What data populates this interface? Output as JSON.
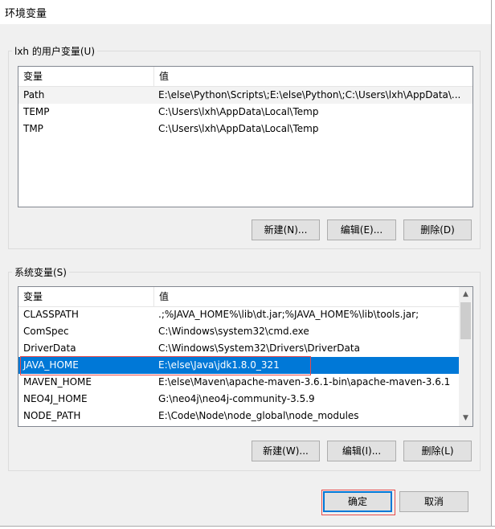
{
  "window": {
    "title": "环境变量"
  },
  "user_vars": {
    "group_label": "lxh 的用户变量(U)",
    "columns": [
      "变量",
      "值"
    ],
    "rows": [
      {
        "name": "Path",
        "value": "E:\\else\\Python\\Scripts\\;E:\\else\\Python\\;C:\\Users\\lxh\\AppData\\..."
      },
      {
        "name": "TEMP",
        "value": "C:\\Users\\lxh\\AppData\\Local\\Temp"
      },
      {
        "name": "TMP",
        "value": "C:\\Users\\lxh\\AppData\\Local\\Temp"
      }
    ],
    "buttons": {
      "new": "新建(N)...",
      "edit": "编辑(E)...",
      "delete": "删除(D)"
    }
  },
  "system_vars": {
    "group_label": "系统变量(S)",
    "columns": [
      "变量",
      "值"
    ],
    "rows": [
      {
        "name": "CLASSPATH",
        "value": ".;%JAVA_HOME%\\lib\\dt.jar;%JAVA_HOME%\\lib\\tools.jar;"
      },
      {
        "name": "ComSpec",
        "value": "C:\\Windows\\system32\\cmd.exe"
      },
      {
        "name": "DriverData",
        "value": "C:\\Windows\\System32\\Drivers\\DriverData"
      },
      {
        "name": "JAVA_HOME",
        "value": "E:\\else\\Java\\jdk1.8.0_321"
      },
      {
        "name": "MAVEN_HOME",
        "value": "E:\\else\\Maven\\apache-maven-3.6.1-bin\\apache-maven-3.6.1"
      },
      {
        "name": "NEO4J_HOME",
        "value": "G:\\neo4j\\neo4j-community-3.5.9"
      },
      {
        "name": "NODE_PATH",
        "value": "E:\\Code\\Node\\node_global\\node_modules"
      }
    ],
    "selected_index": 3,
    "buttons": {
      "new": "新建(W)...",
      "edit": "编辑(I)...",
      "delete": "删除(L)"
    }
  },
  "footer": {
    "ok": "确定",
    "cancel": "取消"
  },
  "colors": {
    "selection": "#0078d7",
    "highlight_outline": "#e64b4b"
  }
}
